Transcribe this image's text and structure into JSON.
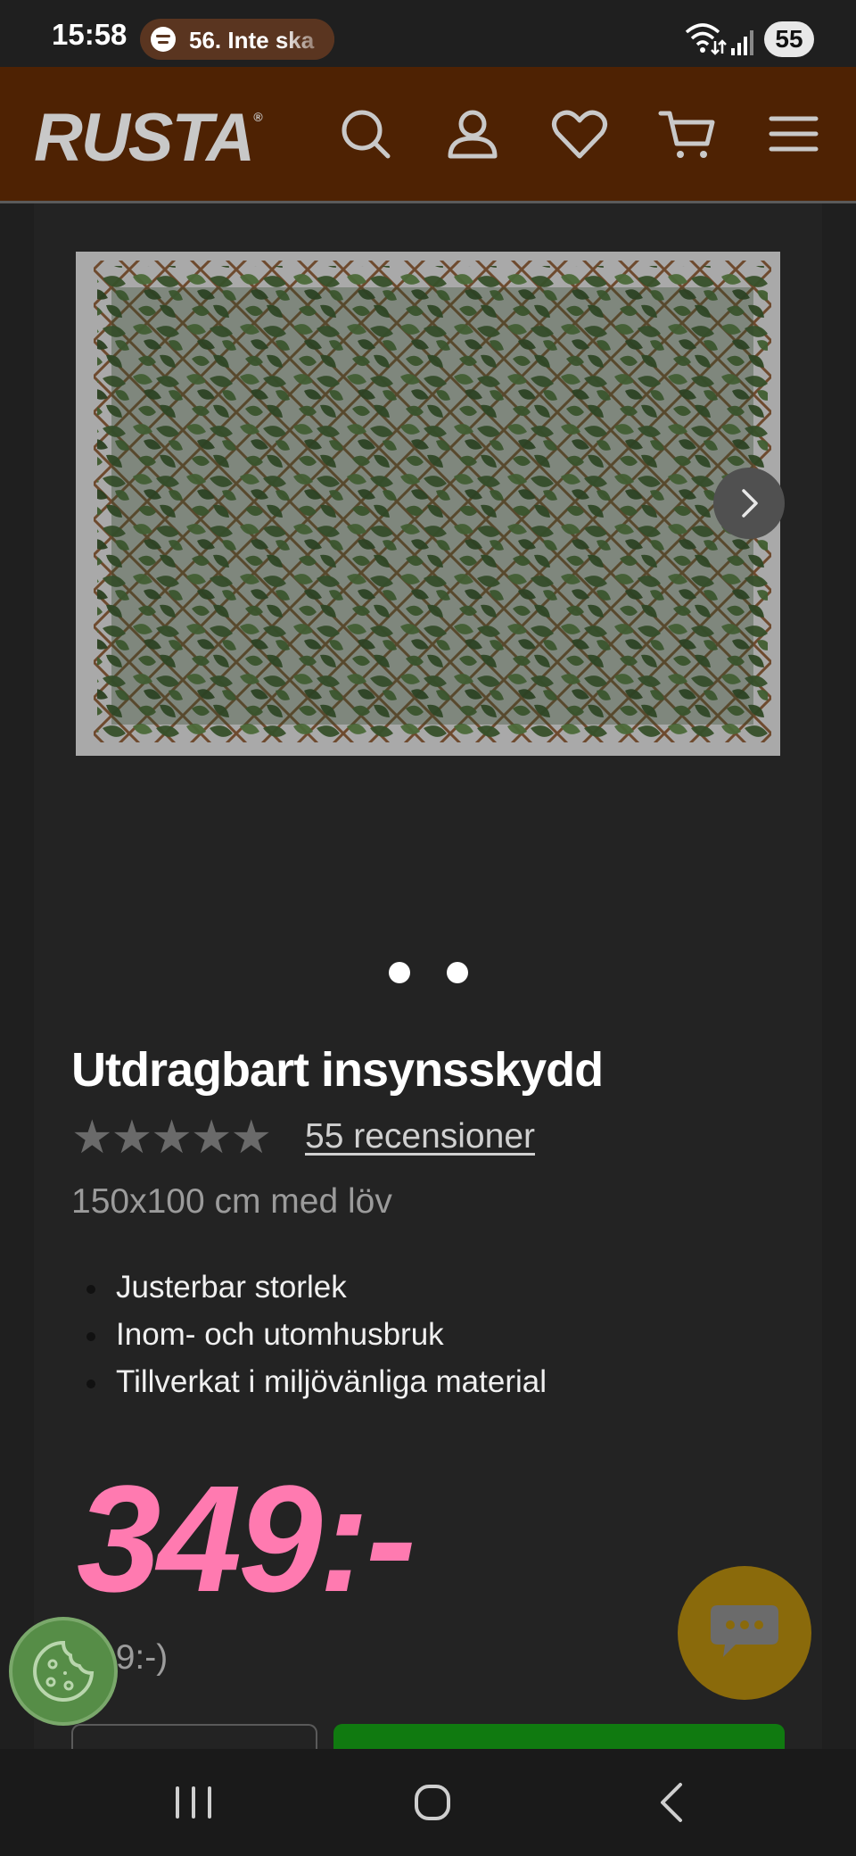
{
  "status_bar": {
    "time": "15:58",
    "media_text": "56. Inte ska",
    "battery": "55"
  },
  "header": {
    "logo": "RUSTA",
    "logo_mark": "®",
    "icons": [
      "search-icon",
      "account-icon",
      "heart-icon",
      "cart-icon",
      "menu-icon"
    ]
  },
  "product": {
    "title": "Utdragbart insynsskydd",
    "rating": 5,
    "stars": [
      "★",
      "★",
      "★",
      "★",
      "★"
    ],
    "reviews_link": "55 recensioner",
    "subtitle": "150x100 cm med löv",
    "features": [
      "Justerbar storlek",
      "Inom- och utomhusbruk",
      "Tillverkat i miljövänliga material"
    ],
    "price": "349:-",
    "old_price": "99:-)"
  },
  "gallery": {
    "image_count": 2,
    "active_index": 0
  },
  "colors": {
    "header_bg": "#4e2203",
    "price": "#ff7ab0",
    "cart_button": "#107a10",
    "chat_button": "#8a6a0b",
    "cookie_button": "#568d47"
  }
}
